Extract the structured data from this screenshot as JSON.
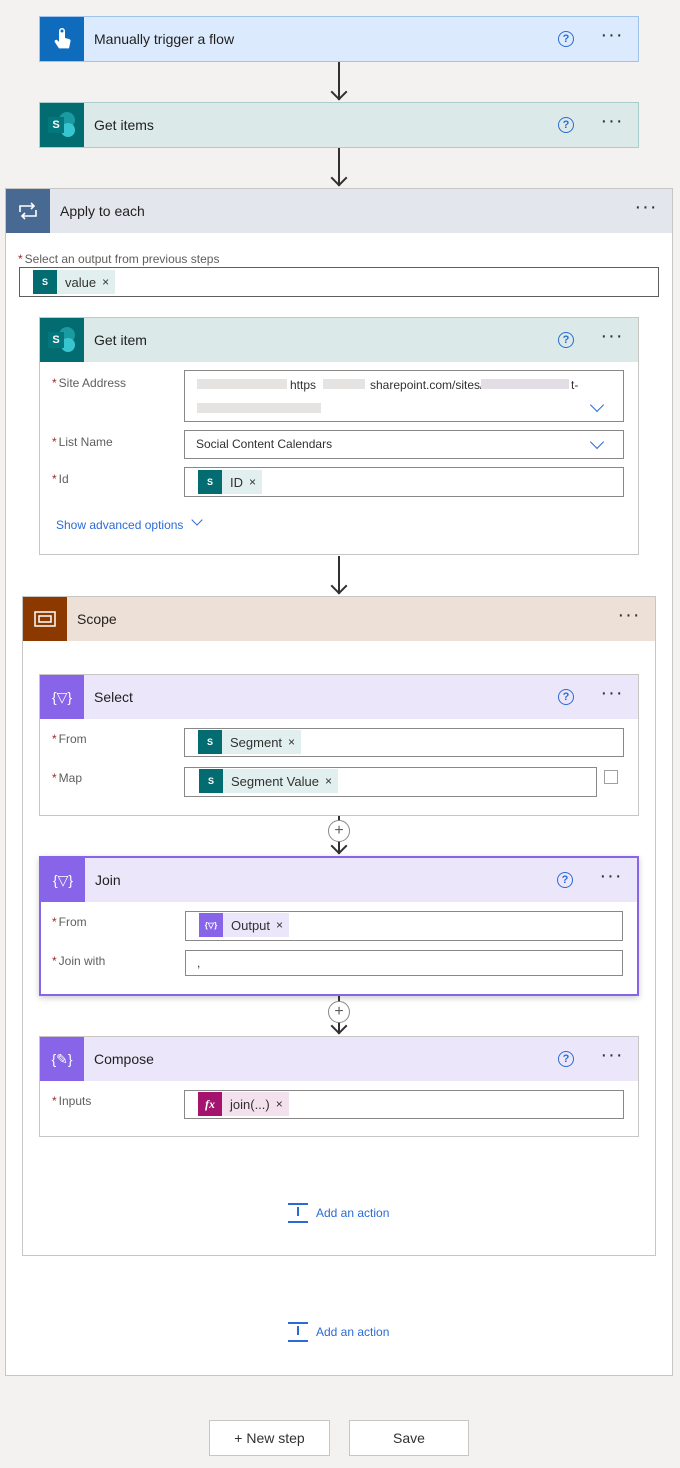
{
  "trigger": {
    "title": "Manually trigger a flow",
    "color": "#0f6cbd"
  },
  "get_items": {
    "title": "Get items"
  },
  "apply_each": {
    "title": "Apply to each",
    "select_label": "Select an output from previous steps",
    "token": "value"
  },
  "get_item": {
    "title": "Get item",
    "site_label": "Site Address",
    "site_value_a": "https",
    "site_value_b": "sharepoint.com/sites/",
    "site_value_c": "t-",
    "list_label": "List Name",
    "list_value": "Social Content Calendars",
    "id_label": "Id",
    "id_token": "ID",
    "advanced": "Show advanced options"
  },
  "scope": {
    "title": "Scope"
  },
  "select": {
    "title": "Select",
    "from_label": "From",
    "from_token": "Segment",
    "map_label": "Map",
    "map_token": "Segment Value"
  },
  "join": {
    "title": "Join",
    "from_label": "From",
    "from_token": "Output",
    "with_label": "Join with",
    "with_value": ","
  },
  "compose": {
    "title": "Compose",
    "inputs_label": "Inputs",
    "inputs_token": "join(...)"
  },
  "add_action_inner": "Add an action",
  "add_action_outer": "Add an action",
  "footer": {
    "new_step": "+ New step",
    "save": "Save"
  },
  "colors": {
    "trigger_bg": "#dbeafd",
    "sp_bg": "#dbe9e8",
    "apply_bg": "#e3e6ed",
    "scope_bg": "#ede0d7",
    "dataop_bg": "#ece6fb",
    "sharepoint": "#036c70",
    "dataop": "#8764e8",
    "expression": "#a4136d"
  }
}
